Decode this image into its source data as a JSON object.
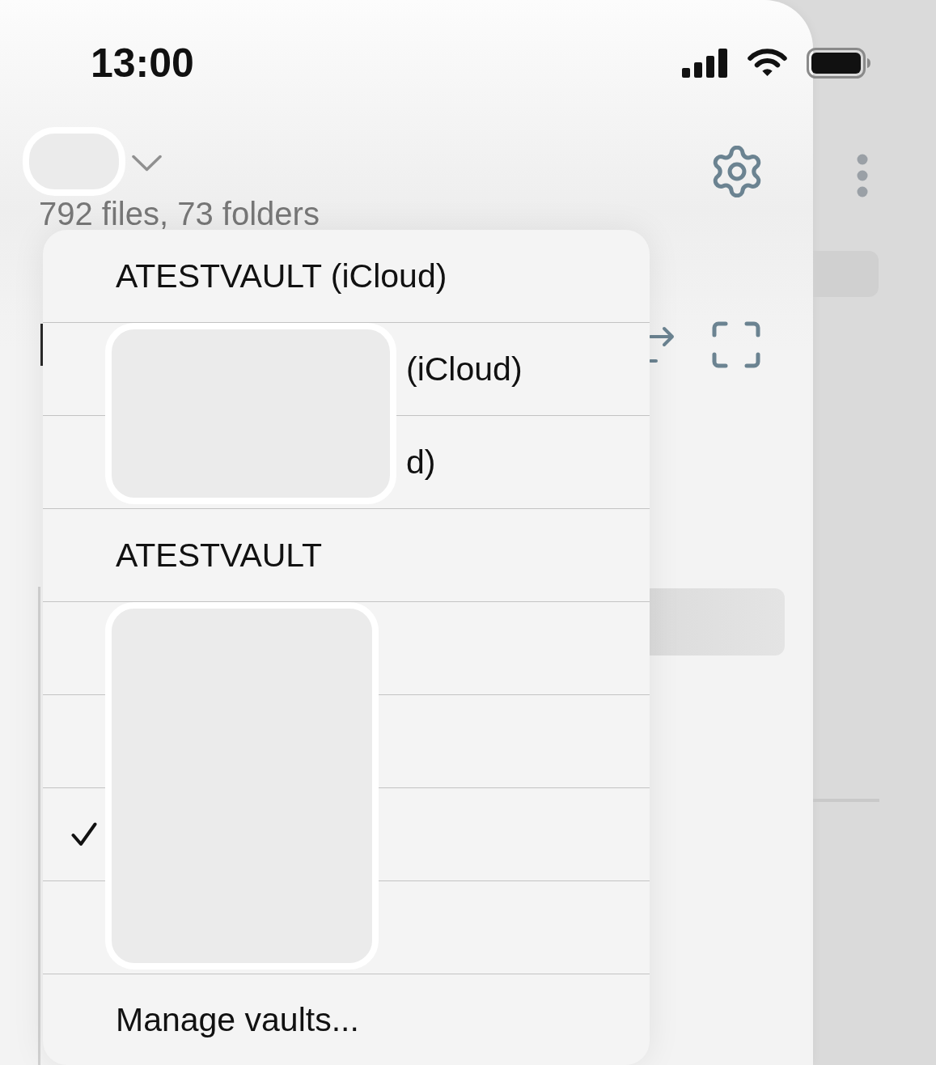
{
  "status_bar": {
    "time": "13:00"
  },
  "header": {
    "vault_switcher": {
      "redacted": true
    }
  },
  "file_count": "792 files, 73 folders",
  "vault_menu": {
    "items": [
      {
        "label": "ATESTVAULT (iCloud)",
        "selected": false,
        "redacted": false
      },
      {
        "label": "(iCloud)",
        "selected": false,
        "redacted": true
      },
      {
        "label": "d)",
        "selected": false,
        "redacted": true
      },
      {
        "label": "ATESTVAULT",
        "selected": false,
        "redacted": false
      },
      {
        "selected": false,
        "redacted": true
      },
      {
        "selected": false,
        "redacted": true
      },
      {
        "selected": true,
        "redacted": true
      },
      {
        "selected": false,
        "redacted": true
      }
    ],
    "manage_action": {
      "label": "Manage vaults..."
    }
  }
}
